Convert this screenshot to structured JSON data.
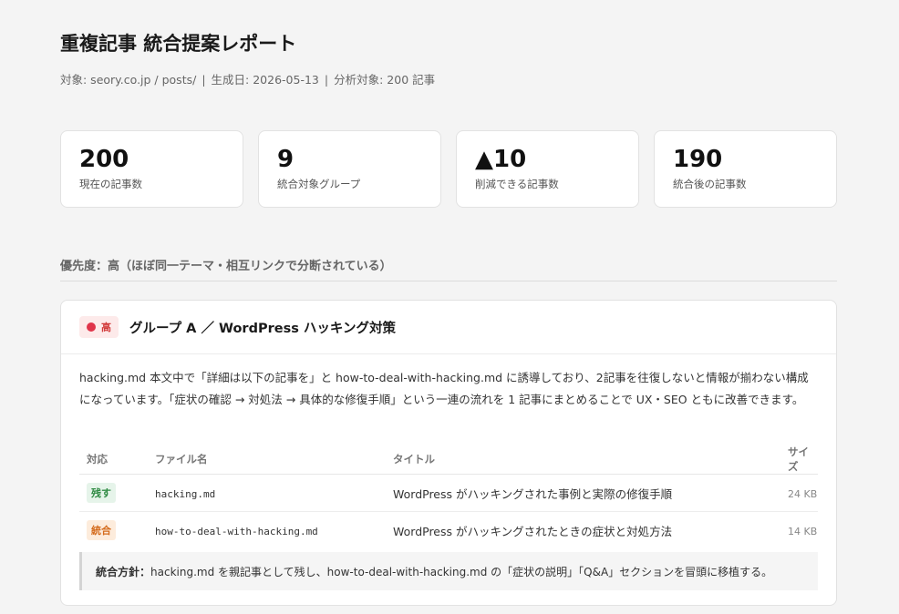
{
  "report": {
    "title": "重複記事 統合提案レポート",
    "meta_target": "対象: seory.co.jp / posts/",
    "meta_separator": "|",
    "meta_generated": "生成日: 2026-05-13",
    "meta_analyzed": "分析対象: 200 記事"
  },
  "stats": [
    {
      "value": "200",
      "label": "現在の記事数"
    },
    {
      "value": "9",
      "label": "統合対象グループ"
    },
    {
      "value": "▲10",
      "label": "削減できる記事数"
    },
    {
      "value": "190",
      "label": "統合後の記事数"
    }
  ],
  "section": {
    "heading": "優先度：高（ほぼ同一テーマ・相互リンクで分断されている）"
  },
  "group": {
    "priority_label": "高",
    "priority_color": "#e0344a",
    "title": "グループ A ／ WordPress ハッキング対策",
    "description": "hacking.md 本文中で「詳細は以下の記事を」と how-to-deal-with-hacking.md に誘導しており、2記事を往復しないと情報が揃わない構成になっています。「症状の確認 → 対処法 → 具体的な修復手順」という一連の流れを 1 記事にまとめることで UX・SEO ともに改善できます。",
    "table": {
      "headers": {
        "action": "対応",
        "file": "ファイル名",
        "title": "タイトル",
        "size": "サイズ"
      },
      "rows": [
        {
          "action": "残す",
          "action_type": "keep",
          "file": "hacking.md",
          "title": "WordPress がハッキングされた事例と実際の修復手順",
          "size": "24 KB"
        },
        {
          "action": "統合",
          "action_type": "merge",
          "file": "how-to-deal-with-hacking.md",
          "title": "WordPress がハッキングされたときの症状と対処方法",
          "size": "14 KB"
        }
      ]
    },
    "policy_label": "統合方針：",
    "policy_text": "hacking.md を親記事として残し、how-to-deal-with-hacking.md の「症状の説明」「Q&A」セクションを冒頭に移植する。"
  }
}
